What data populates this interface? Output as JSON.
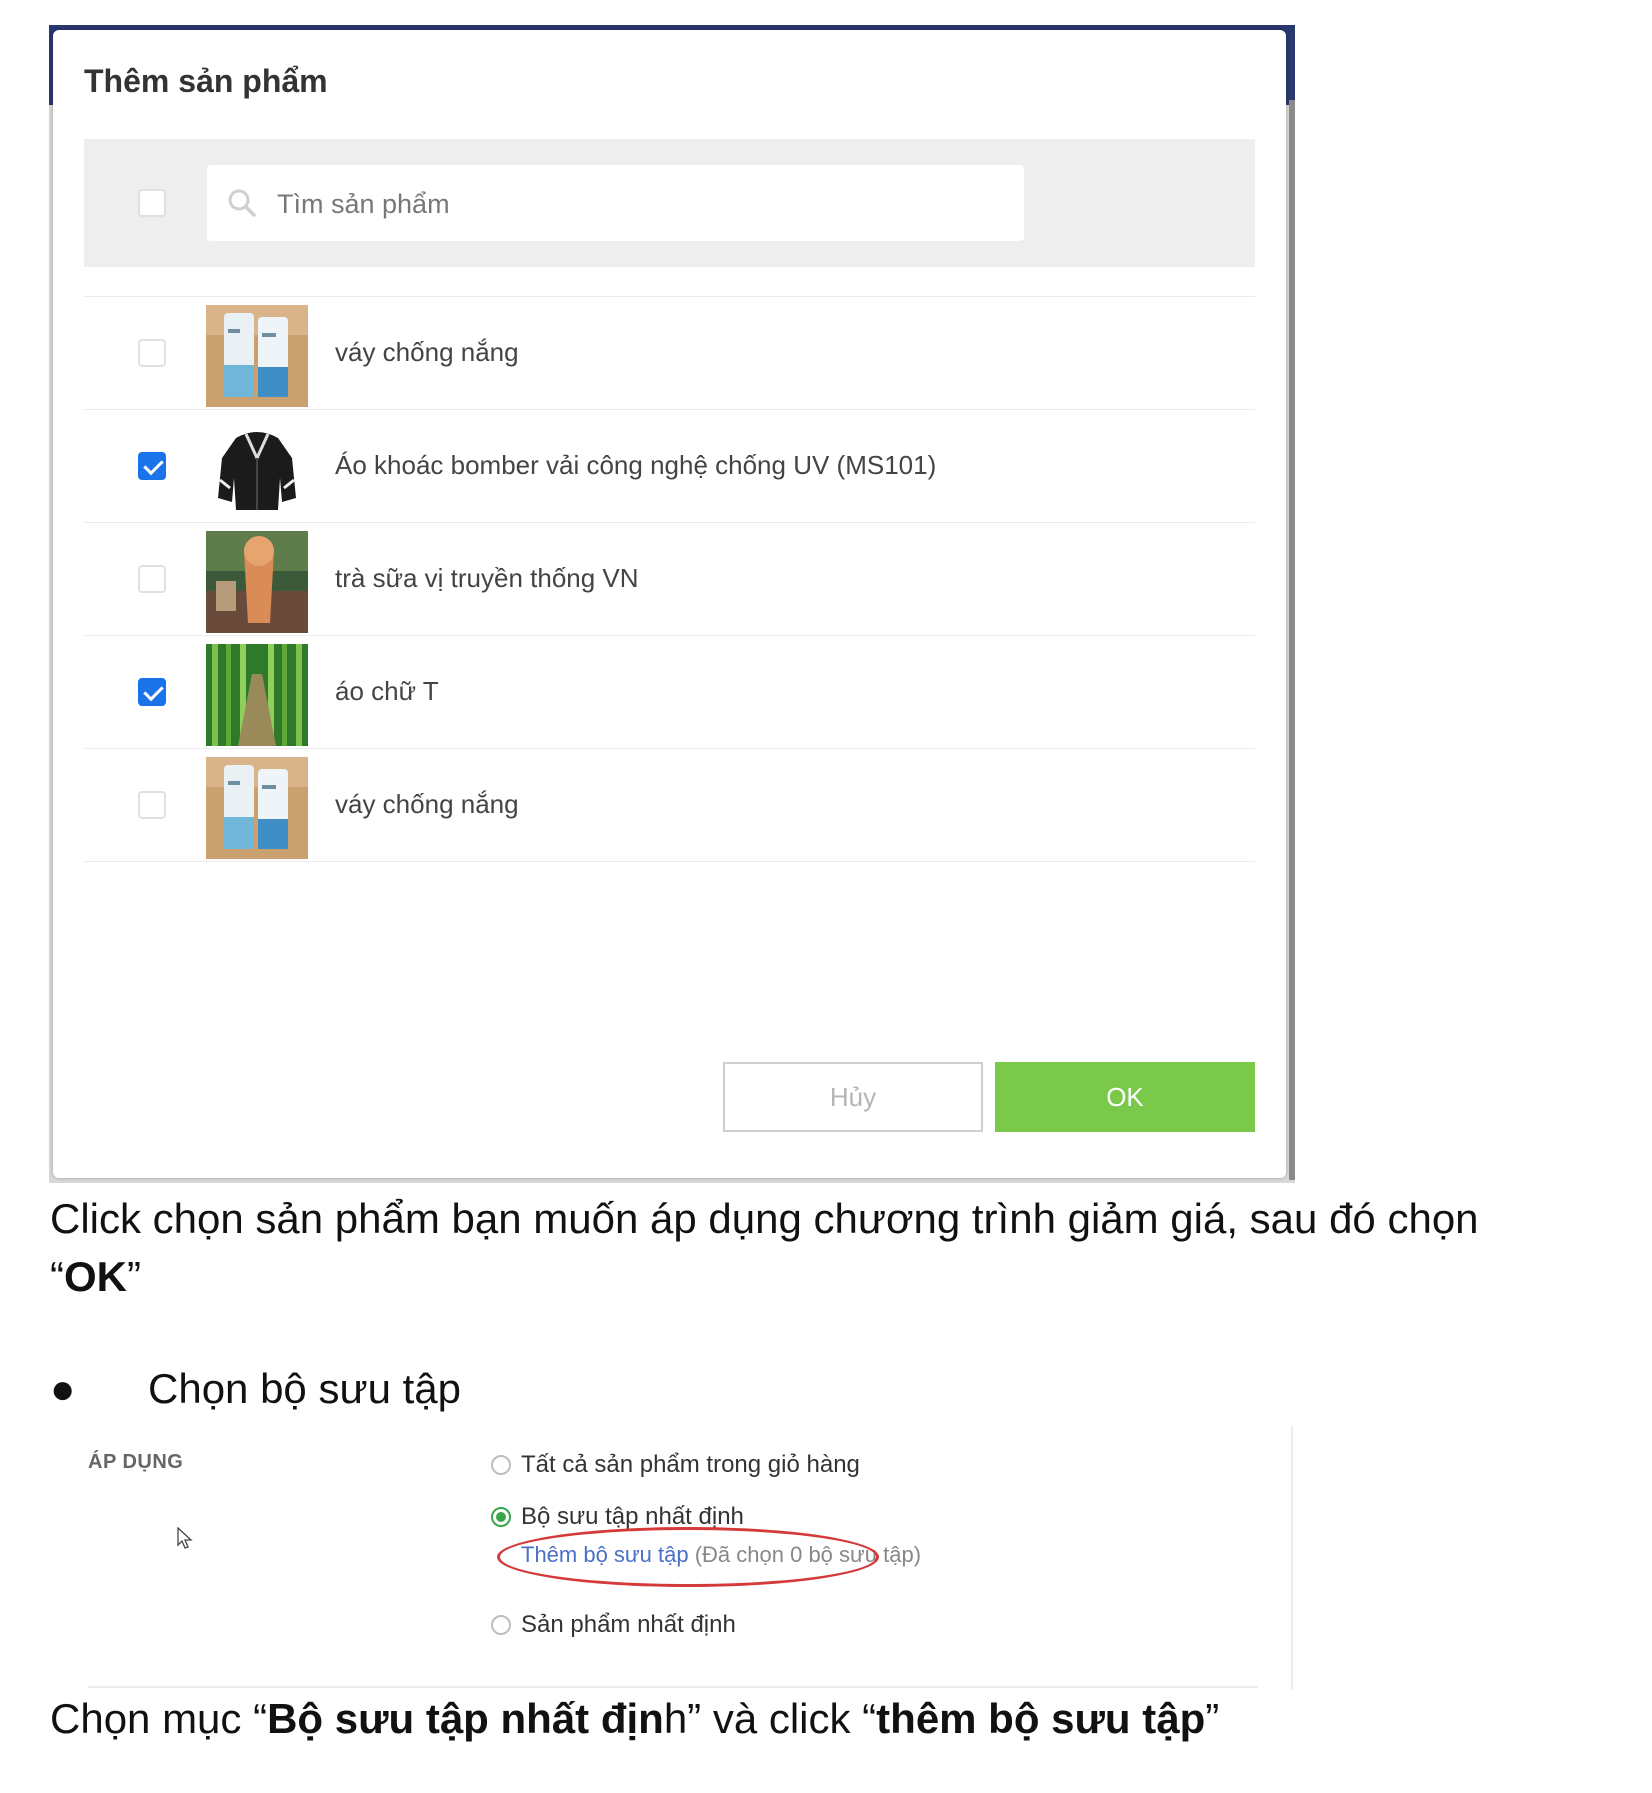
{
  "modal": {
    "title": "Thêm sản phẩm",
    "search_placeholder": "Tìm sản phẩm",
    "cancel_label": "Hủy",
    "ok_label": "OK",
    "products": [
      {
        "name": "váy chống nắng",
        "checked": false,
        "thumb": "sunscreen-bottles"
      },
      {
        "name": "Áo khoác bomber vải công nghệ chống UV (MS101)",
        "checked": true,
        "thumb": "bomber-jacket"
      },
      {
        "name": "trà sữa vị truyền thống VN",
        "checked": false,
        "thumb": "milk-tea"
      },
      {
        "name": "áo chữ T",
        "checked": true,
        "thumb": "bamboo-forest"
      },
      {
        "name": "váy chống nắng",
        "checked": false,
        "thumb": "sunscreen-bottles"
      }
    ]
  },
  "caption1": {
    "text": "Click chọn sản phẩm bạn muốn áp dụng chương trình giảm giá, sau đó chọn ",
    "quote_open": "“",
    "bold": "OK",
    "quote_close": "”"
  },
  "bullet": {
    "symbol": "●",
    "text": "Chọn bộ sưu tập"
  },
  "apply": {
    "label": "ÁP DỤNG",
    "options": [
      {
        "label": "Tất cả sản phẩm trong giỏ hàng",
        "selected": false
      },
      {
        "label": "Bộ sưu tập nhất định",
        "selected": true
      },
      {
        "label": "Sản phẩm nhất định",
        "selected": false
      }
    ],
    "add_collection_link": "Thêm bộ sưu tập",
    "selected_count": "(Đã chọn 0 bộ sưu tập)"
  },
  "caption2": {
    "part1": "Chọn mục “",
    "bold1": "Bộ sưu tập nhất địn",
    "part2": "h” và click “",
    "bold2": "thêm bộ sưu tập",
    "part3": "”"
  },
  "colors": {
    "ok_button": "#7ac94a",
    "checkbox_checked": "#1a73e8",
    "radio_selected": "#3aa64a",
    "highlight_ellipse": "#d43a3a",
    "link": "#4a6fc7",
    "app_header": "#2a3870"
  }
}
